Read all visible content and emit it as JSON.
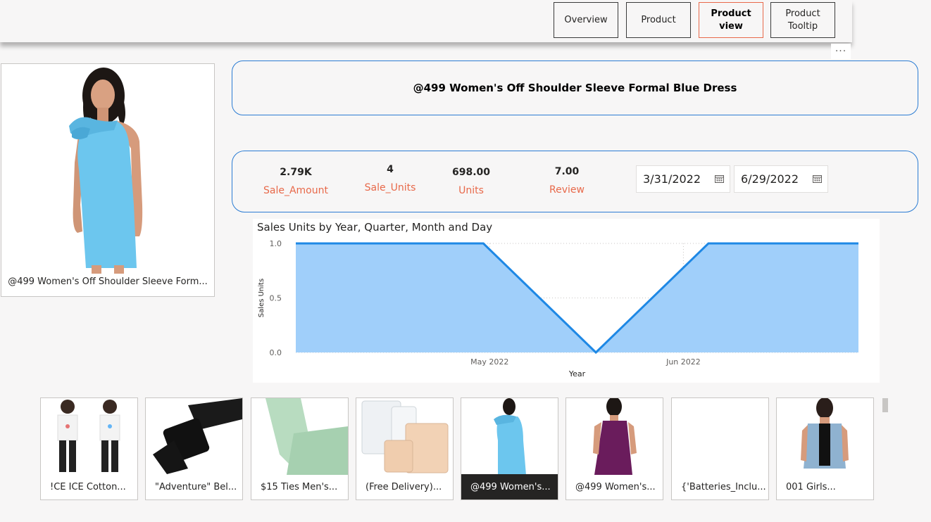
{
  "nav": {
    "buttons": [
      {
        "label": "Overview",
        "active": false
      },
      {
        "label": "Product",
        "active": false
      },
      {
        "label": "Product view",
        "active": true
      },
      {
        "label": "Product Tooltip",
        "active": false
      }
    ],
    "more_menu": "···"
  },
  "product": {
    "image_caption": "@499 Women's Off Shoulder Sleeve Form...",
    "title": "@499 Women's Off Shoulder Sleeve Formal Blue Dress"
  },
  "kpis": [
    {
      "value": "2.79K",
      "label": "Sale_Amount"
    },
    {
      "value": "4",
      "label": "Sale_Units"
    },
    {
      "value": "698.00",
      "label": "Units"
    },
    {
      "value": "7.00",
      "label": "Review"
    }
  ],
  "dates": {
    "start": "3/31/2022",
    "end": "6/29/2022"
  },
  "chart_data": {
    "type": "area",
    "title": "Sales Units by Year, Quarter, Month and Day",
    "xlabel": "Year",
    "ylabel": "Sales Units",
    "x_ticks": [
      "May 2022",
      "Jun 2022"
    ],
    "y_ticks": [
      "0.0",
      "0.5",
      "1.0"
    ],
    "ylim": [
      0,
      1
    ],
    "series": [
      {
        "x": [
          "2022-03-31",
          "2022-05-29",
          "2022-06-06",
          "2022-06-29"
        ],
        "values": [
          1,
          0,
          1,
          1
        ]
      }
    ],
    "xlim": [
      "2022-03-31",
      "2022-06-29"
    ],
    "vertices": [
      {
        "date": "2022-03-31",
        "value": 1
      },
      {
        "date": "2022-04-30",
        "value": 1
      },
      {
        "date": "2022-05-18",
        "value": 0
      },
      {
        "date": "2022-06-05",
        "value": 1
      },
      {
        "date": "2022-06-29",
        "value": 1
      }
    ],
    "grid": true,
    "colors": {
      "line": "#1e88e5",
      "fill": "#a0cffa"
    }
  },
  "thumbnails": [
    {
      "caption": "!CE ICE Cotton...",
      "icon": "kids-tshirts",
      "selected": false
    },
    {
      "caption": "\"Adventure\" Bel...",
      "icon": "black-belt",
      "selected": false
    },
    {
      "caption": "$15 Ties Men's...",
      "icon": "green-tie",
      "selected": false
    },
    {
      "caption": "(Free Delivery)...",
      "icon": "bra-extenders",
      "selected": false
    },
    {
      "caption": "@499 Women's...",
      "icon": "blue-dress",
      "selected": true
    },
    {
      "caption": "@499 Women's...",
      "icon": "purple-dress",
      "selected": false
    },
    {
      "caption": "{'Batteries_Inclu...",
      "icon": "blank",
      "selected": false
    },
    {
      "caption": "001 Girls...",
      "icon": "denim-vest",
      "selected": false
    }
  ],
  "colors": {
    "accent": "#e8694a",
    "border_blue": "#2b7cd3",
    "selected_bg": "#252423"
  }
}
